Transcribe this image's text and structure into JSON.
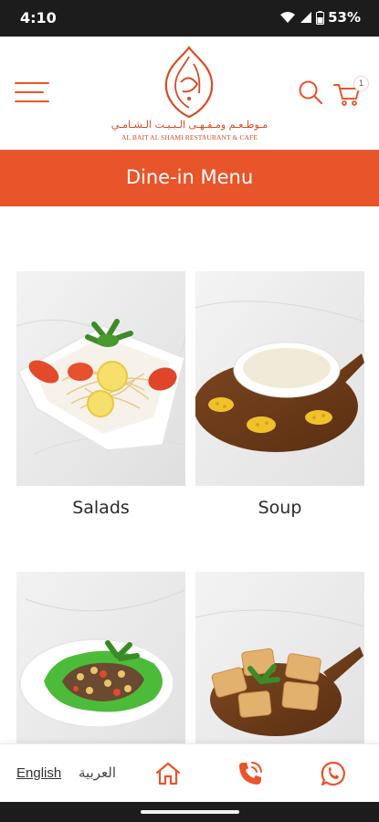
{
  "status_bar": {
    "time": "4:10",
    "battery": "53%"
  },
  "header": {
    "logo_arabic": "مـوطـعـم ومـقـهـى الـبـيـت الـشـامـي",
    "logo_english": "AL BAIT AL SHAMI RESTAURANT & CAFE",
    "cart_count": "1"
  },
  "title_bar": {
    "title": "Dine-in Menu"
  },
  "menu": {
    "categories": [
      {
        "label": "Salads"
      },
      {
        "label": "Soup"
      },
      {
        "label": ""
      },
      {
        "label": ""
      }
    ]
  },
  "bottom_nav": {
    "english_label": "English",
    "arabic_label": "العربية"
  },
  "colors": {
    "accent": "#e8552a",
    "status_bar": "#1c1c1c"
  },
  "icons": [
    "menu-icon",
    "search-icon",
    "cart-icon",
    "home-icon",
    "phone-icon",
    "whatsapp-icon"
  ]
}
